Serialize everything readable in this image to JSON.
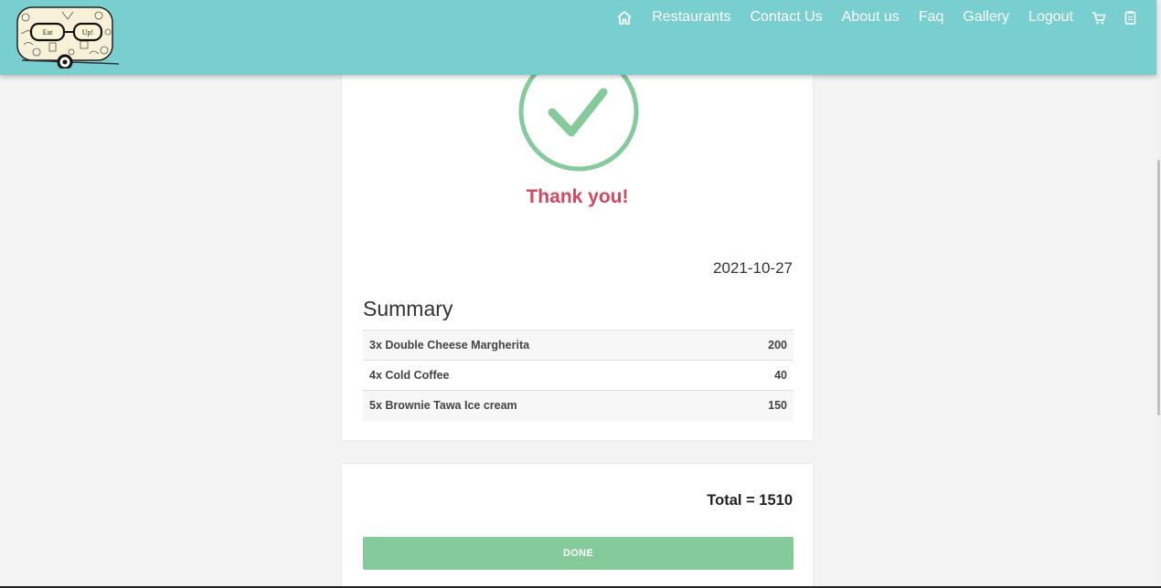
{
  "nav": {
    "links": [
      "Restaurants",
      "Contact Us",
      "About us",
      "Faq",
      "Gallery",
      "Logout"
    ],
    "icons": [
      "home-icon",
      "cart-icon",
      "clipboard-icon"
    ],
    "logo_text": [
      "Eat",
      "Up!"
    ]
  },
  "receipt": {
    "thank_you": "Thank you!",
    "date": "2021-10-27",
    "summary_title": "Summary",
    "items": [
      {
        "label": "3x Double Cheese Margherita",
        "amount": "200"
      },
      {
        "label": "4x Cold Coffee",
        "amount": "40"
      },
      {
        "label": "5x Brownie Tawa Ice cream",
        "amount": "150"
      }
    ]
  },
  "total": {
    "text": "Total = 1510",
    "done_label": "DONE"
  },
  "colors": {
    "navbar": "#79cfd0",
    "check": "#85ca9b",
    "thank_you": "#d04862",
    "done_button": "#85ca9b",
    "background": "#f3f3f3"
  }
}
